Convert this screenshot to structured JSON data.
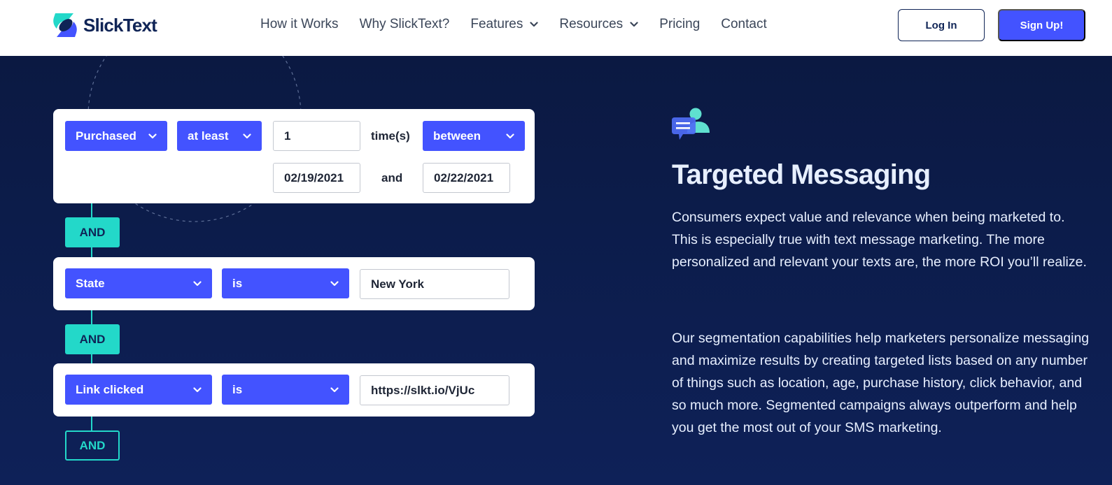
{
  "header": {
    "brand": "SlickText",
    "nav": [
      {
        "label": "How it Works",
        "has_dropdown": false
      },
      {
        "label": "Why SlickText?",
        "has_dropdown": false
      },
      {
        "label": "Features",
        "has_dropdown": true
      },
      {
        "label": "Resources",
        "has_dropdown": true
      },
      {
        "label": "Pricing",
        "has_dropdown": false
      },
      {
        "label": "Contact",
        "has_dropdown": false
      }
    ],
    "login_label": "Log In",
    "signup_label": "Sign Up!"
  },
  "segment_builder": {
    "rule1": {
      "field": "Purchased",
      "operator": "at least",
      "count_value": "1",
      "count_unit": "time(s)",
      "range_operator": "between",
      "start_date": "02/19/2021",
      "joiner": "and",
      "end_date": "02/22/2021"
    },
    "connector1": "AND",
    "rule2": {
      "field": "State",
      "operator": "is",
      "value": "New York"
    },
    "connector2": "AND",
    "rule3": {
      "field": "Link clicked",
      "operator": "is",
      "value": "https://slkt.io/VjUc"
    },
    "connector3": "AND"
  },
  "feature": {
    "icon": "chat-person-icon",
    "title": "Targeted Messaging",
    "paragraph1": "Consumers expect value and relevance when being marketed to. This is especially true with text message marketing. The more personalized and relevant your texts are, the more ROI you’ll realize.",
    "paragraph2": "Our segmentation capabilities help marketers personalize messaging and maximize results by creating targeted lists based on any number of things such as location, age, purchase history, click behavior, and so much more. Segmented campaigns always outperform and help you get the most out of your SMS marketing."
  },
  "colors": {
    "brand_blue": "#4353ff",
    "navy": "#0f2456",
    "teal": "#23d8c9",
    "hero_bg": "#0b1942"
  }
}
